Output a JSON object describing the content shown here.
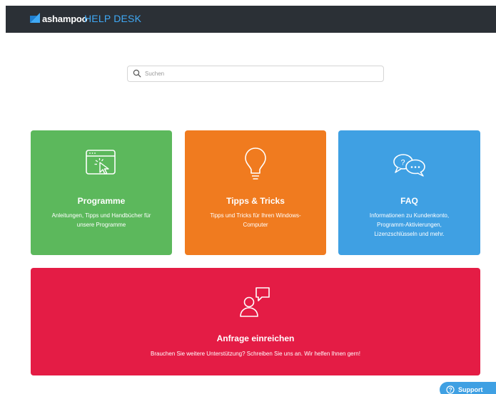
{
  "header": {
    "brand": "ashampoo",
    "section": "HELP DESK",
    "accent_color": "#3fa9f5",
    "background_color": "#2b3036"
  },
  "search": {
    "placeholder": "Suchen",
    "value": "",
    "icon": "search-icon"
  },
  "cards": [
    {
      "title": "Programme",
      "description": "Anleitungen, Tipps und Handbücher für unsere Programme",
      "icon": "browser-cursor-icon",
      "color": "#5cb85c"
    },
    {
      "title": "Tipps & Tricks",
      "description": "Tipps und Tricks für Ihren Windows-Computer",
      "icon": "lightbulb-icon",
      "color": "#f07b1f"
    },
    {
      "title": "FAQ",
      "description": "Informationen zu Kundenkonto, Programm-Aktivierungen, Lizenzschlüsseln und mehr.",
      "icon": "speech-bubbles-icon",
      "color": "#3fa0e3"
    }
  ],
  "request": {
    "title": "Anfrage einreichen",
    "description": "Brauchen Sie weitere Unterstützung? Schreiben Sie uns an. Wir helfen Ihnen gern!",
    "icon": "person-chat-icon",
    "color": "#e41c45"
  },
  "support_button": {
    "label": "Support",
    "icon": "question-circle-icon",
    "color": "#3fa0e3"
  }
}
